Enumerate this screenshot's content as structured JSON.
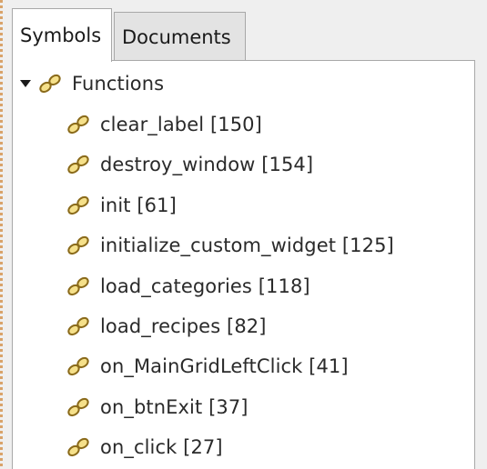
{
  "tabs": [
    {
      "label": "Symbols",
      "active": true
    },
    {
      "label": "Documents",
      "active": false
    }
  ],
  "tree": {
    "group_label": "Functions",
    "expanded": true,
    "items": [
      {
        "label": "clear_label [150]"
      },
      {
        "label": "destroy_window [154]"
      },
      {
        "label": "init [61]"
      },
      {
        "label": "initialize_custom_widget [125]"
      },
      {
        "label": "load_categories [118]"
      },
      {
        "label": "load_recipes [82]"
      },
      {
        "label": "on_MainGridLeftClick [41]"
      },
      {
        "label": "on_btnExit [37]"
      },
      {
        "label": "on_click [27]"
      }
    ]
  },
  "colors": {
    "icon_stroke": "#8a6a1a",
    "icon_fill": "#f5e08a"
  },
  "icons": {
    "expander": "triangle-down-icon",
    "symbol": "function-symbol-icon"
  }
}
